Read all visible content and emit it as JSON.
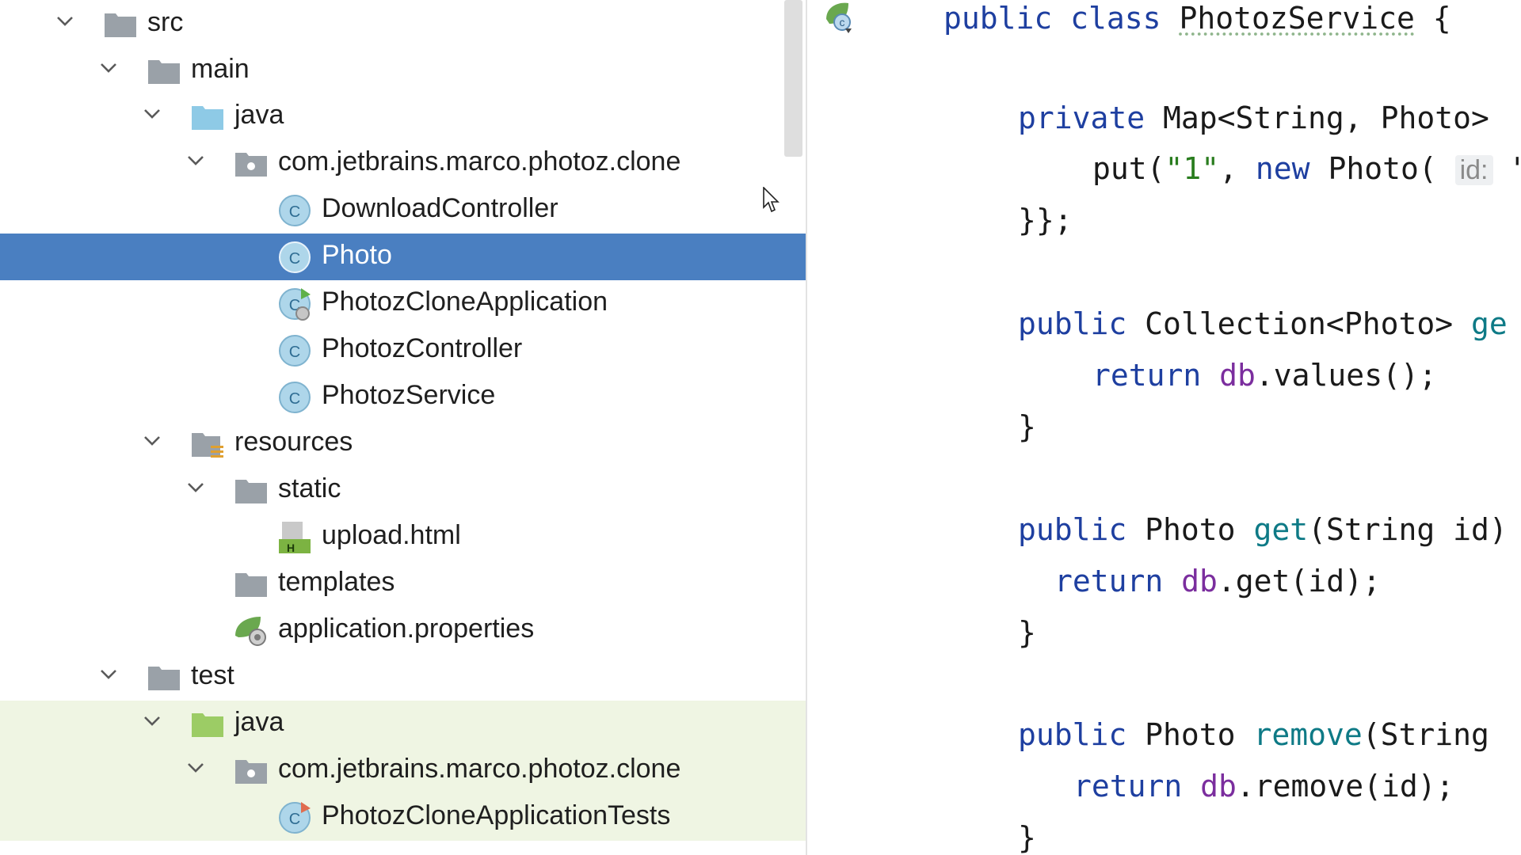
{
  "project_tree": {
    "items": [
      {
        "label": "src",
        "type": "folder"
      },
      {
        "label": "main",
        "type": "folder"
      },
      {
        "label": "java",
        "type": "source-root"
      },
      {
        "label": "com.jetbrains.marco.photoz.clone",
        "type": "package"
      },
      {
        "label": "DownloadController",
        "type": "class"
      },
      {
        "label": "Photo",
        "type": "class"
      },
      {
        "label": "PhotozCloneApplication",
        "type": "spring-app-class"
      },
      {
        "label": "PhotozController",
        "type": "class"
      },
      {
        "label": "PhotozService",
        "type": "class"
      },
      {
        "label": "resources",
        "type": "resources-root"
      },
      {
        "label": "static",
        "type": "folder"
      },
      {
        "label": "upload.html",
        "type": "html-file"
      },
      {
        "label": "templates",
        "type": "folder"
      },
      {
        "label": "application.properties",
        "type": "spring-properties"
      },
      {
        "label": "test",
        "type": "folder"
      },
      {
        "label": "java",
        "type": "test-root"
      },
      {
        "label": "com.jetbrains.marco.photoz.clone",
        "type": "package"
      },
      {
        "label": "PhotozCloneApplicationTests",
        "type": "test-class"
      }
    ],
    "html_file_badge": "H",
    "class_badge": "C"
  },
  "editor": {
    "lines": [
      [
        [
          "kw",
          "public "
        ],
        [
          "kw",
          "class "
        ],
        [
          "plain",
          "PhotozService {"
        ]
      ],
      [
        [
          "kw",
          "private "
        ],
        [
          "plain",
          "Map<String, Photo> "
        ]
      ],
      [
        [
          "plain",
          "put("
        ],
        [
          "str",
          "\"1\""
        ],
        [
          "plain",
          ", "
        ],
        [
          "kw",
          "new "
        ],
        [
          "plain",
          "Photo( "
        ],
        [
          "hint",
          "id:"
        ],
        [
          "plain",
          " \""
        ]
      ],
      [
        [
          "plain",
          "}};"
        ]
      ],
      [
        [
          "kw",
          "public "
        ],
        [
          "plain",
          "Collection<Photo> "
        ],
        [
          "fn",
          "ge"
        ]
      ],
      [
        [
          "kw",
          "return "
        ],
        [
          "fld",
          "db"
        ],
        [
          "plain",
          ".values();"
        ]
      ],
      [
        [
          "plain",
          "}"
        ]
      ],
      [
        [
          "kw",
          "public "
        ],
        [
          "plain",
          "Photo "
        ],
        [
          "fn",
          "get"
        ],
        [
          "plain",
          "(String id)"
        ]
      ],
      [
        [
          "kw",
          "return "
        ],
        [
          "fld",
          "db"
        ],
        [
          "plain",
          ".get(id);"
        ]
      ],
      [
        [
          "plain",
          "}"
        ]
      ],
      [
        [
          "kw",
          "public "
        ],
        [
          "plain",
          "Photo "
        ],
        [
          "fn",
          "remove"
        ],
        [
          "plain",
          "(String"
        ]
      ],
      [
        [
          "kw",
          "return "
        ],
        [
          "fld",
          "db"
        ],
        [
          "plain",
          ".remove(id);"
        ]
      ],
      [
        [
          "plain",
          "}"
        ]
      ]
    ]
  },
  "colors": {
    "selection": "#4a7fc1",
    "test_background": "#eff5e3",
    "keyword": "#1e3fa0",
    "method": "#0e7a86",
    "field": "#7b2e9e",
    "string": "#2a7d1f"
  }
}
